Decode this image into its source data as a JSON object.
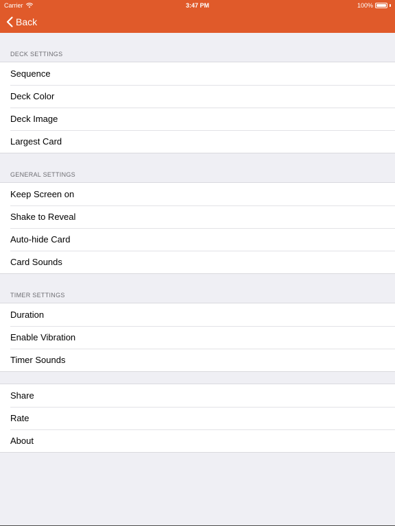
{
  "status_bar": {
    "carrier": "Carrier",
    "time": "3:47 PM",
    "battery": "100%",
    "battery_level": 1.0
  },
  "nav": {
    "back_label": "Back",
    "back_icon": "chevron-left-icon",
    "bar_color": "#e05a2a"
  },
  "sections": [
    {
      "header": "DECK SETTINGS",
      "rows": [
        "Sequence",
        "Deck Color",
        "Deck Image",
        "Largest Card"
      ]
    },
    {
      "header": "GENERAL SETTINGS",
      "rows": [
        "Keep Screen on",
        "Shake to Reveal",
        "Auto-hide Card",
        "Card Sounds"
      ]
    },
    {
      "header": "TIMER SETTINGS",
      "rows": [
        "Duration",
        "Enable Vibration",
        "Timer Sounds"
      ]
    },
    {
      "header": "",
      "rows": [
        "Share",
        "Rate",
        "About"
      ]
    }
  ]
}
